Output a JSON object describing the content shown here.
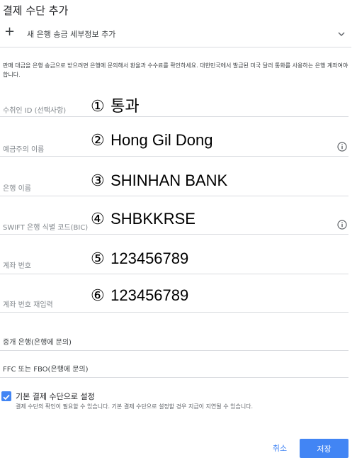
{
  "dialog": {
    "title": "결제 수단 추가",
    "add_bank": {
      "plus": "+",
      "label": "새 은행 송금 세부정보 추가",
      "chevron_icon": "chevron-down-icon"
    },
    "description": "판매 대금을 은행 송금으로 받으려면 은행에 문의해서 환율과 수수료를 확인하세요. 대한민국에서 발급된 미국 달러 통화를 사용하는 은행 계좌여야 합니다."
  },
  "fields": [
    {
      "label": "수취인 ID (선택사항)",
      "marker": "①",
      "value": "통과",
      "info": false
    },
    {
      "label": "예금주의 이름",
      "marker": "②",
      "value": "Hong Gil Dong",
      "info": true
    },
    {
      "label": "은행 이름",
      "marker": "③",
      "value": "SHINHAN BANK",
      "info": false
    },
    {
      "label": "SWIFT 은행 식별 코드(BIC)",
      "marker": "④",
      "value": "SHBKKRSE",
      "info": true
    },
    {
      "label": "계좌 번호",
      "marker": "⑤",
      "value": "123456789",
      "info": false
    },
    {
      "label": "계좌 번호 재입력",
      "marker": "⑥",
      "value": "123456789",
      "info": false
    }
  ],
  "intermediary": {
    "label": "중개 은행(은행에 문의)"
  },
  "ffc": {
    "label": "FFC 또는 FBO(은행에 문의)"
  },
  "default_method": {
    "checked": true,
    "label": "기본 결제 수단으로 설정",
    "note": "결제 수단의 확인이 필요할 수 있습니다. 기본 결제 수단으로 설정할 경우 지급이 지연될 수 있습니다."
  },
  "actions": {
    "cancel_label": "취소",
    "save_label": "저장"
  },
  "colors": {
    "accent": "#4285f4",
    "divider": "#dadce0",
    "muted_label": "#80868b"
  }
}
